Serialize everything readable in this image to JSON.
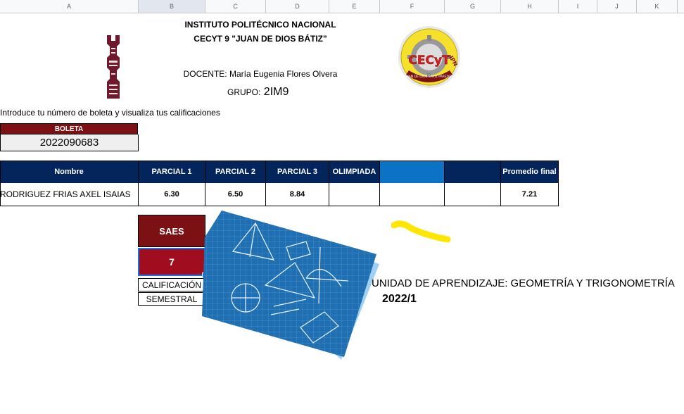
{
  "columns": [
    "A",
    "B",
    "C",
    "D",
    "E",
    "F",
    "G",
    "H",
    "I",
    "J",
    "K"
  ],
  "header": {
    "line1": "INSTITUTO POLITÉCNICO NACIONAL",
    "line2": "CECYT 9 \"JUAN DE DIOS BÁTIZ\"",
    "docente": "DOCENTE: María Eugenia Flores Olvera",
    "grupo_label": "GRUPO:",
    "grupo_value": "2IM9"
  },
  "logo_right": {
    "letters": "CECyT",
    "ring_text": "JUAN DE DIOS BÁTIZ PAREDES",
    "corner": "IPN"
  },
  "instruction": "Introduce tu número de boleta y visualiza tus calificaciones",
  "boleta": {
    "label": "BOLETA",
    "value": "2022090683"
  },
  "table": {
    "headers": [
      "Nombre",
      "PARCIAL 1",
      "PARCIAL 2",
      "PARCIAL 3",
      "OLIMPIADA",
      "",
      "",
      "Promedio final"
    ],
    "row": [
      "RODRIGUEZ FRIAS AXEL ISAIAS",
      "6.30",
      "6.50",
      "8.84",
      "",
      "",
      "",
      "7.21"
    ]
  },
  "saes": {
    "label": "SAES",
    "value": "7",
    "cal_label": "CALIFICACIÓN",
    "sem_label": "SEMESTRAL"
  },
  "unidad": {
    "label": "UNIDAD DE APRENDIZAJE: GEOMETRÍA Y TRIGONOMETRÍA",
    "period": "2022/1"
  },
  "colors": {
    "navy": "#04245c",
    "maroon": "#7b1113",
    "red": "#a00d1f",
    "blue_cell": "#0b72c6",
    "yellow": "#ffe600"
  }
}
